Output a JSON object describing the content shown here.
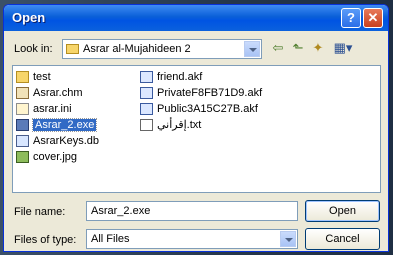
{
  "window": {
    "title": "Open",
    "help_label": "?",
    "close_label": "✕"
  },
  "lookin": {
    "label": "Look in:",
    "value": "Asrar al-Mujahideen 2"
  },
  "toolbar": {
    "back": "⇦",
    "up": "⬑",
    "new_folder": "✦",
    "views": "▦▾"
  },
  "files": {
    "col1": [
      {
        "name": "test",
        "icon": "folder-icon"
      },
      {
        "name": "Asrar.chm",
        "icon": "chm-icon"
      },
      {
        "name": "asrar.ini",
        "icon": "ini-icon"
      },
      {
        "name": "Asrar_2.exe",
        "icon": "exe-icon",
        "selected": true
      },
      {
        "name": "AsrarKeys.db",
        "icon": "db-icon"
      },
      {
        "name": "cover.jpg",
        "icon": "jpg-icon"
      }
    ],
    "col2": [
      {
        "name": "friend.akf",
        "icon": "akf-icon"
      },
      {
        "name": "PrivateF8FB71D9.akf",
        "icon": "akf-icon"
      },
      {
        "name": "Public3A15C27B.akf",
        "icon": "akf-icon"
      },
      {
        "name": "إقرأني.txt",
        "icon": "txt-icon"
      }
    ]
  },
  "filename": {
    "label": "File name:",
    "value": "Asrar_2.exe"
  },
  "filetype": {
    "label": "Files of type:",
    "value": "All Files"
  },
  "buttons": {
    "open": "Open",
    "cancel": "Cancel"
  }
}
